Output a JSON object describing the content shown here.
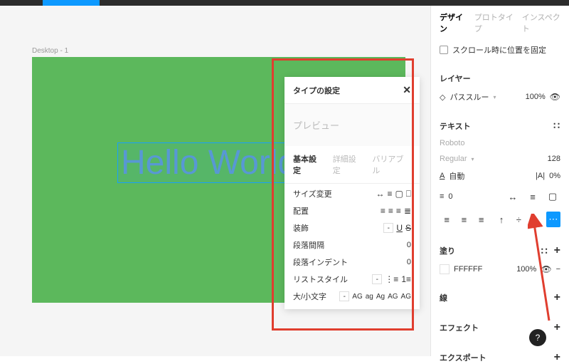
{
  "frameLabel": "Desktop - 1",
  "canvasText": "Hello World",
  "sidebar": {
    "tabs": {
      "design": "デザイン",
      "prototype": "プロトタイプ",
      "inspect": "インスペクト"
    },
    "fixScroll": "スクロール時に位置を固定",
    "layer": {
      "header": "レイヤー",
      "mode": "パススルー",
      "opacity": "100%"
    },
    "text": {
      "header": "テキスト",
      "font": "Roboto",
      "weight": "Regular",
      "size": "128",
      "lineAuto": "自動",
      "letter": "0%",
      "para": "0"
    },
    "fill": {
      "header": "塗り",
      "hex": "FFFFFF",
      "opacity": "100%"
    },
    "stroke": {
      "header": "線"
    },
    "effects": {
      "header": "エフェクト"
    },
    "export": {
      "header": "エクスポート"
    }
  },
  "typePanel": {
    "title": "タイプの設定",
    "preview": "プレビュー",
    "tabs": {
      "basic": "基本設定",
      "advanced": "詳細設定",
      "variable": "バリアブル"
    },
    "rows": {
      "resize": "サイズ変更",
      "align": "配置",
      "decoration": "装飾",
      "paraSpacing": "段落間隔",
      "paraIndent": "段落インデント",
      "listStyle": "リストスタイル",
      "case": "大/小文字"
    },
    "paraSpacingVal": "0",
    "paraIndentVal": "0",
    "caseOptions": [
      "AG",
      "ag",
      "Ag",
      "AG",
      "AG"
    ]
  },
  "help": "?"
}
